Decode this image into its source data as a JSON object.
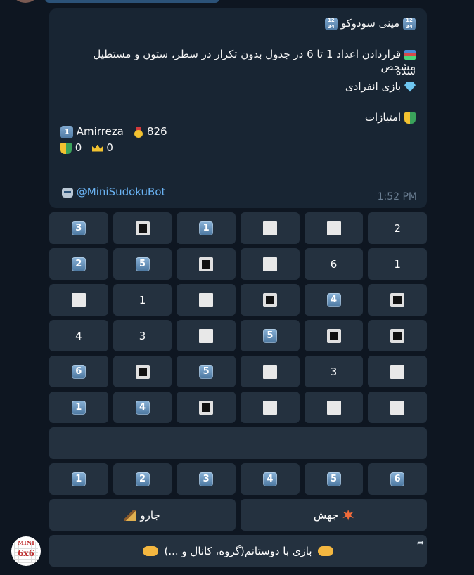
{
  "message": {
    "title": "مینی سودوکو",
    "title_icon": "🔢",
    "rule_icon": "books-icon",
    "rule_line1": "قراردادن اعداد 1 تا 6 در جدول بدون تکرار در سطر، ستون و مستطیل مشخص",
    "rule_line2": "شده",
    "mode_label": "بازی انفرادی",
    "scores_label": "امتیازات",
    "player_rank": "1",
    "player_name": "Amirreza",
    "player_score": "826",
    "stat_a": "0",
    "stat_b": "0",
    "via": "@MiniSudokuBot",
    "time": "1:52 PM"
  },
  "grid": [
    [
      {
        "t": "key",
        "v": "3"
      },
      {
        "t": "black"
      },
      {
        "t": "key",
        "v": "1"
      },
      {
        "t": "white"
      },
      {
        "t": "white"
      },
      {
        "t": "text",
        "v": "2"
      }
    ],
    [
      {
        "t": "key",
        "v": "2"
      },
      {
        "t": "key",
        "v": "5"
      },
      {
        "t": "black"
      },
      {
        "t": "white"
      },
      {
        "t": "text",
        "v": "6"
      },
      {
        "t": "text",
        "v": "1"
      }
    ],
    [
      {
        "t": "white"
      },
      {
        "t": "text",
        "v": "1"
      },
      {
        "t": "white"
      },
      {
        "t": "black"
      },
      {
        "t": "key",
        "v": "4"
      },
      {
        "t": "black"
      }
    ],
    [
      {
        "t": "text",
        "v": "4"
      },
      {
        "t": "text",
        "v": "3"
      },
      {
        "t": "white"
      },
      {
        "t": "key",
        "v": "5"
      },
      {
        "t": "black"
      },
      {
        "t": "black"
      }
    ],
    [
      {
        "t": "key",
        "v": "6"
      },
      {
        "t": "black"
      },
      {
        "t": "key",
        "v": "5"
      },
      {
        "t": "white"
      },
      {
        "t": "text",
        "v": "3"
      },
      {
        "t": "white"
      }
    ],
    [
      {
        "t": "key",
        "v": "1"
      },
      {
        "t": "key",
        "v": "4"
      },
      {
        "t": "black"
      },
      {
        "t": "white"
      },
      {
        "t": "white"
      },
      {
        "t": "white"
      }
    ]
  ],
  "number_pad": [
    "1",
    "2",
    "3",
    "4",
    "5",
    "6"
  ],
  "actions": {
    "broom_label": "جارو",
    "jump_label": "جهش"
  },
  "share": {
    "label": "بازی با دوستانم(گروه، کانال و ...)"
  },
  "avatar": {
    "line1": "MINI",
    "line2": "6x6"
  }
}
